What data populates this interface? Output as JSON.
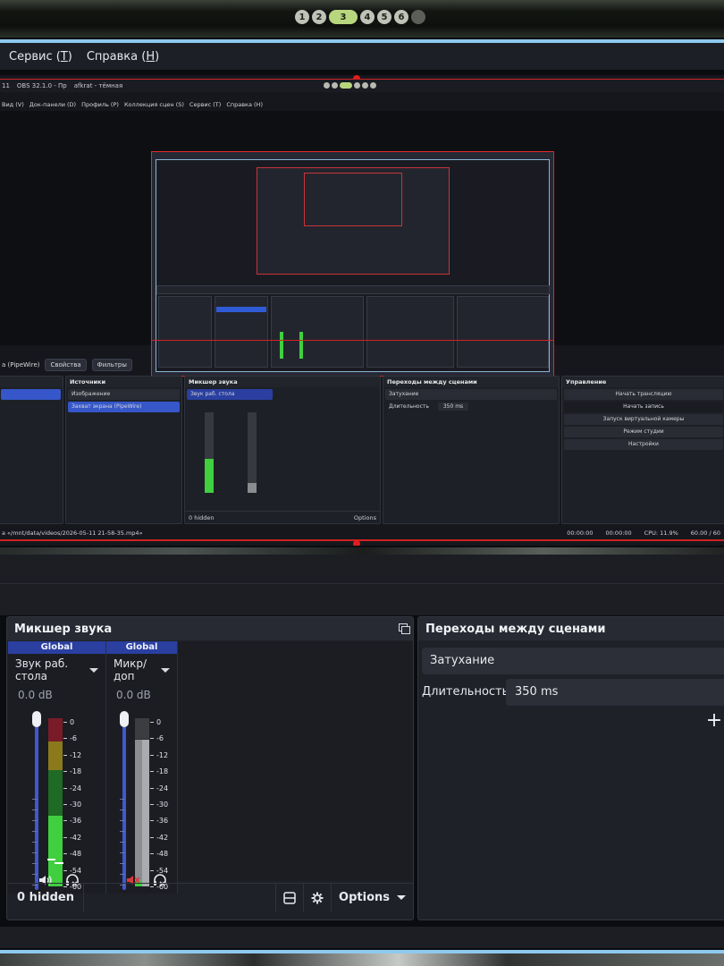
{
  "workspaces": [
    "1",
    "2",
    "3",
    "4",
    "5",
    "6",
    ""
  ],
  "active_workspace": "3",
  "menu": {
    "tools": "Сервис (Т)",
    "tools_letter": "Т",
    "help": "Справка (Н)",
    "help_letter": "Н"
  },
  "inner": {
    "topbar": [
      "11",
      "OBS 32.1.0 - Пр",
      "afkrat - тёмная"
    ],
    "menu": [
      "Вид (V)",
      "Док-панели (D)",
      "Профиль (P)",
      "Коллекция сцен (S)",
      "Сервис (T)",
      "Справка (H)"
    ],
    "toolbar": [
      "a (PipeWire)",
      "Свойства",
      "Фильтры"
    ],
    "docks": {
      "sources_title": "Источники",
      "sources": [
        "Изображение",
        "Захват экрана (PipeWire)"
      ],
      "mixer_title": "Микшер звука",
      "mixer_channels": [
        "Звук раб. стола",
        "Микр/доп"
      ],
      "transitions_title": "Переходы между сценами",
      "transition": "Затухание",
      "duration_label": "Длительность",
      "duration_value": "350 ms",
      "controls_title": "Управление",
      "controls": [
        "Начать трансляцию",
        "Начать запись",
        "Запуск виртуальной камеры",
        "Режим студии",
        "Настройки"
      ],
      "hidden": "0 hidden",
      "options": "Options"
    },
    "status": {
      "path": "a «/mnt/data/videos/2026-05-11 21-58-35.mp4»",
      "rec_time": "00:00:00",
      "stream_time": "00:00:00",
      "cpu": "CPU: 11.9%",
      "fps": "60.00 / 60"
    }
  },
  "mixer": {
    "title": "Микшер звука",
    "channels": [
      {
        "header": "Global",
        "name": "Звук раб. стола",
        "db": "0.0 dB",
        "level": 0.42,
        "peak": 0.17,
        "muted": false
      },
      {
        "header": "Global",
        "name": "Микр/доп",
        "db": "0.0 dB",
        "level": 0.87,
        "peak": 0.17,
        "muted": true
      }
    ],
    "scale": [
      "0",
      "-6",
      "-12",
      "-18",
      "-24",
      "-30",
      "-36",
      "-42",
      "-48",
      "-54",
      "-60"
    ],
    "hidden": "0 hidden",
    "options": "Options"
  },
  "transitions": {
    "title": "Переходы между сценами",
    "selected": "Затухание",
    "duration_label": "Длительность",
    "duration_value": "350 ms",
    "add": "+"
  },
  "colors": {
    "accent": "#3f58cf",
    "channel_header": "#2a3fa0",
    "meter_green": "#3fcf3f",
    "meter_yellow": "#8a7a1c",
    "meter_red": "#7a1b28",
    "mute_red": "#d83a3a",
    "highlight_line": "#8ec9ee",
    "selection_red": "#d02323"
  }
}
